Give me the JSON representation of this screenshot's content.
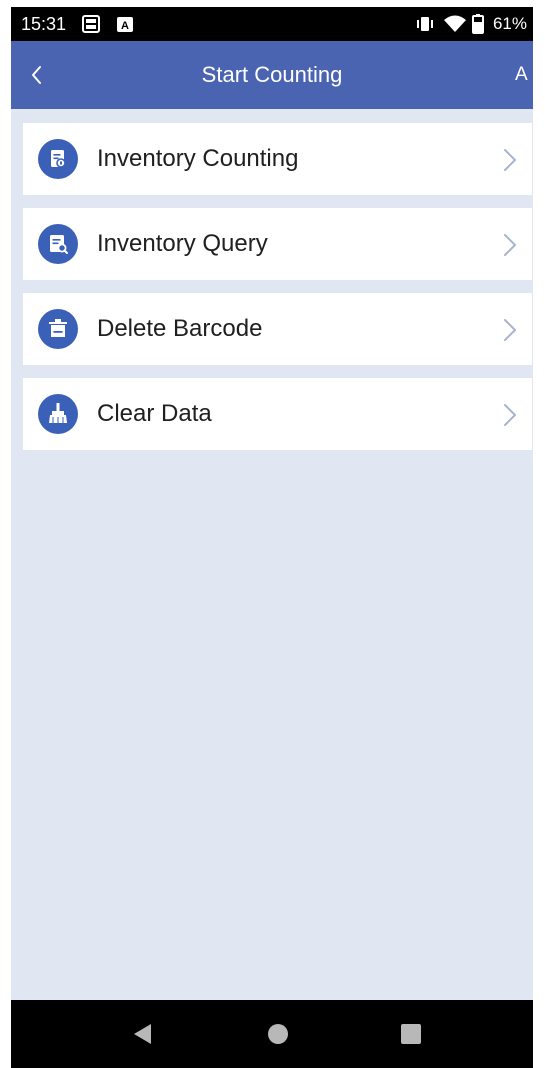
{
  "status_bar": {
    "time": "15:31",
    "battery_percent": "61%",
    "icons": [
      "screenshot-icon",
      "notification-a-icon",
      "vibrate-icon",
      "wifi-icon",
      "battery-icon"
    ]
  },
  "app_bar": {
    "title": "Start Counting",
    "right_action": "A",
    "back_icon": "chevron-left-icon"
  },
  "menu": {
    "items": [
      {
        "label": "Inventory Counting",
        "icon": "inventory-counting-icon"
      },
      {
        "label": "Inventory Query",
        "icon": "inventory-query-icon"
      },
      {
        "label": "Delete Barcode",
        "icon": "trash-icon"
      },
      {
        "label": "Clear Data",
        "icon": "broom-icon"
      }
    ]
  },
  "nav_bar": {
    "buttons": [
      "back-triangle-icon",
      "home-circle-icon",
      "recents-square-icon"
    ]
  },
  "colors": {
    "app_bar": "#4a64b2",
    "icon_circle": "#3a60b7",
    "background": "#e0e7f3",
    "item_background": "#ffffff",
    "text": "#202020",
    "chevron": "#a8b4cc"
  }
}
